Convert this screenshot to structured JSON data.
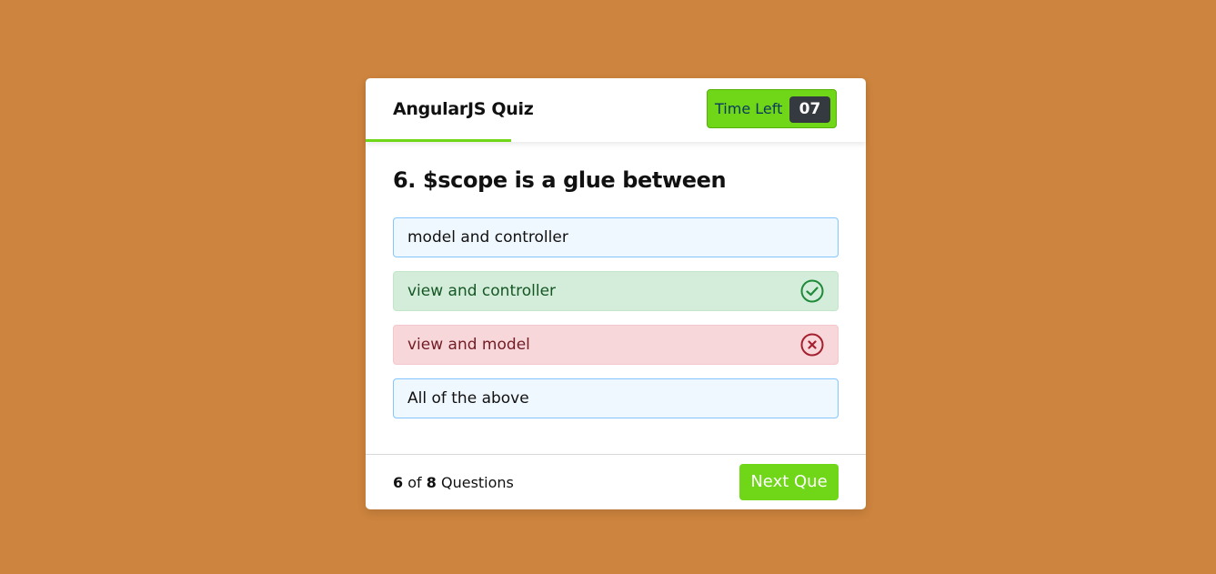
{
  "header": {
    "title": "AngularJS Quiz",
    "timer_label": "Time Left",
    "timer_value": "07",
    "time_line_progress": 0.29
  },
  "question": {
    "number": "6.",
    "text": "6. $scope is a glue between"
  },
  "options": [
    {
      "label": "model and controller",
      "state": "neutral"
    },
    {
      "label": "view and controller",
      "state": "correct",
      "icon": "check-circle-icon"
    },
    {
      "label": "view and model",
      "state": "incorrect",
      "icon": "x-circle-icon"
    },
    {
      "label": "All of the above",
      "state": "neutral"
    }
  ],
  "footer": {
    "current": "6",
    "of": "of",
    "total": "8",
    "suffix": "Questions",
    "next_label": "Next Que"
  },
  "colors": {
    "background": "#CD843E",
    "accent": "#6fd618",
    "correct": "#155724",
    "incorrect": "#721c24"
  }
}
